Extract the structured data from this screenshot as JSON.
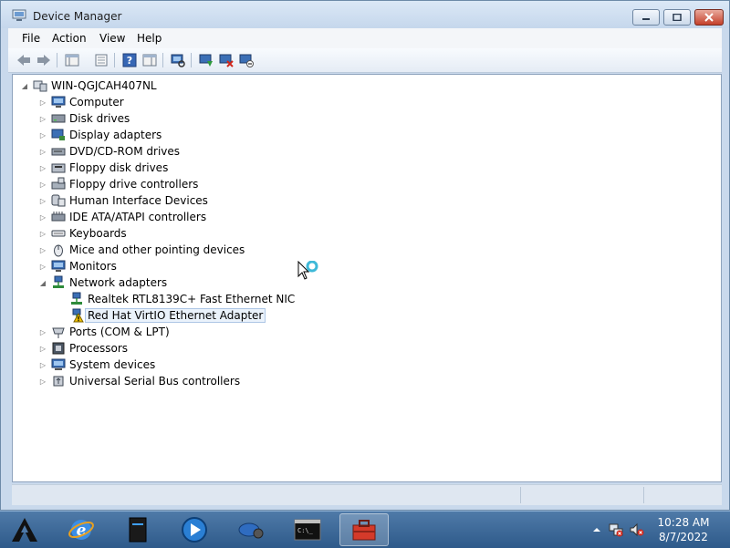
{
  "window": {
    "title": "Device Manager",
    "icon": "device-manager-icon"
  },
  "menu": [
    "File",
    "Action",
    "View",
    "Help"
  ],
  "toolbar": {
    "icons": [
      "back-arrow-icon",
      "forward-arrow-icon",
      "console-tree-icon",
      "properties-icon",
      "help-icon",
      "action-pane-icon",
      "scan-hardware-icon",
      "update-driver-icon",
      "uninstall-icon",
      "disable-icon"
    ]
  },
  "tree": {
    "root": "WIN-QGJCAH407NL",
    "categories": [
      {
        "label": "Computer",
        "expanded": false
      },
      {
        "label": "Disk drives",
        "expanded": false
      },
      {
        "label": "Display adapters",
        "expanded": false
      },
      {
        "label": "DVD/CD-ROM drives",
        "expanded": false
      },
      {
        "label": "Floppy disk drives",
        "expanded": false
      },
      {
        "label": "Floppy drive controllers",
        "expanded": false
      },
      {
        "label": "Human Interface Devices",
        "expanded": false
      },
      {
        "label": "IDE ATA/ATAPI controllers",
        "expanded": false
      },
      {
        "label": "Keyboards",
        "expanded": false
      },
      {
        "label": "Mice and other pointing devices",
        "expanded": false
      },
      {
        "label": "Monitors",
        "expanded": false
      },
      {
        "label": "Network adapters",
        "expanded": true,
        "children": [
          {
            "label": "Realtek RTL8139C+ Fast Ethernet NIC",
            "warning": false,
            "selected": false
          },
          {
            "label": "Red Hat VirtIO Ethernet Adapter",
            "warning": true,
            "selected": true
          }
        ]
      },
      {
        "label": "Ports (COM & LPT)",
        "expanded": false
      },
      {
        "label": "Processors",
        "expanded": false
      },
      {
        "label": "System devices",
        "expanded": false
      },
      {
        "label": "Universal Serial Bus controllers",
        "expanded": false
      }
    ]
  },
  "taskbar": {
    "apps": [
      "start-logo-icon",
      "internet-explorer-icon",
      "storage-drive-icon",
      "media-player-icon",
      "network-gear-icon",
      "command-prompt-icon",
      "toolbox-icon"
    ],
    "active_index": 6,
    "time": "10:28 AM",
    "date": "8/7/2022"
  },
  "colors": {
    "selection": "#eaf2fb",
    "warning": "#f2c200",
    "taskbar": "#3a6798"
  }
}
